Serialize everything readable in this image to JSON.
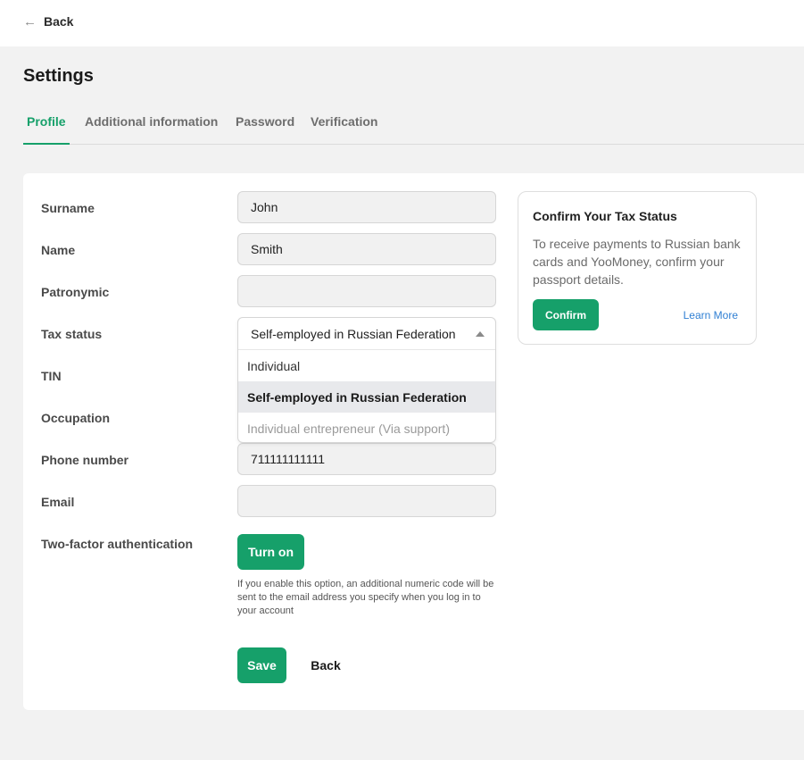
{
  "nav": {
    "back_label": "Back"
  },
  "page": {
    "title": "Settings"
  },
  "tabs": [
    {
      "label": "Profile",
      "active": true
    },
    {
      "label": "Additional information",
      "active": false
    },
    {
      "label": "Password",
      "active": false
    },
    {
      "label": "Verification",
      "active": false
    }
  ],
  "form": {
    "labels": {
      "surname": "Surname",
      "name": "Name",
      "patronymic": "Patronymic",
      "tax_status": "Tax status",
      "tin": "TIN",
      "occupation": "Occupation",
      "phone": "Phone number",
      "email": "Email",
      "two_factor": "Two-factor authentication"
    },
    "values": {
      "surname": "John",
      "name": "Smith",
      "patronymic": "",
      "phone": "711111111111",
      "email": ""
    },
    "tax_status": {
      "selected": "Self-employed in Russian Federation",
      "options": [
        {
          "label": "Individual",
          "state": "normal"
        },
        {
          "label": "Self-employed in Russian Federation",
          "state": "selected"
        },
        {
          "label": "Individual entrepreneur (Via support)",
          "state": "disabled"
        }
      ]
    },
    "two_factor": {
      "button_label": "Turn on",
      "helper": "If you enable this option, an additional numeric code will be sent to the email address you specify when you log in to your account"
    },
    "actions": {
      "save_label": "Save",
      "back_label": "Back"
    }
  },
  "tax_card": {
    "title": "Confirm Your Tax Status",
    "text": "To receive payments to Russian bank cards and YooMoney, confirm your passport details.",
    "confirm_label": "Confirm",
    "learn_more_label": "Learn More"
  },
  "colors": {
    "accent": "#16a06a",
    "link": "#2f7fd3",
    "page_bg": "#f2f2f2"
  },
  "icons": {
    "back": "arrow-left-icon",
    "dropdown": "caret-up-icon"
  }
}
